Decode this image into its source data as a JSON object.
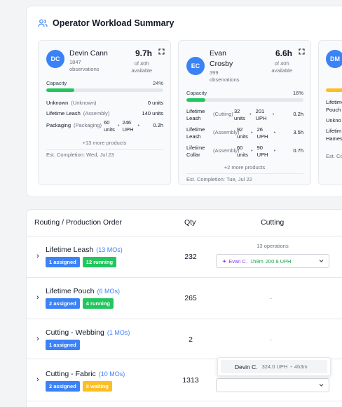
{
  "summary": {
    "title": "Operator Workload Summary",
    "operators": [
      {
        "initials": "DC",
        "name": "Devin Cann",
        "observations": "1847 observations",
        "hours": "9.7h",
        "available_top": "of 40h",
        "available_bottom": "available",
        "capacity_label": "Capacity",
        "capacity_pct": "24%",
        "capacity_value": 24,
        "work": [
          {
            "name": "Unknown",
            "op": "(Unknown)",
            "units": "0 units"
          },
          {
            "name": "Lifetime Leash",
            "op": "(Assembly)",
            "units": "140 units"
          },
          {
            "name": "Packaging",
            "op": "(Packaging)",
            "units_a": "60",
            "units_b": "units",
            "uph_a": "246",
            "uph_b": "UPH",
            "time": "0.2h"
          }
        ],
        "more": "+13 more products",
        "est": "Est. Completion: Wed, Jul 23"
      },
      {
        "initials": "EC",
        "name_a": "Evan",
        "name_b": "Crosby",
        "observations": "399 observations",
        "hours": "6.6h",
        "available_top": "of 40h",
        "available_bottom": "available",
        "capacity_label": "Capacity",
        "capacity_pct": "16%",
        "capacity_value": 16,
        "work": [
          {
            "name_a": "Lifetime",
            "name_b": "Leash",
            "op": "(Cutting)",
            "units_a": "32",
            "units_b": "units",
            "uph_a": "201",
            "uph_b": "UPH",
            "time": "0.2h"
          },
          {
            "name_a": "Lifetime",
            "name_b": "Leash",
            "op": "(Assembly)",
            "units_a": "92",
            "units_b": "units",
            "uph_a": "26",
            "uph_b": "UPH",
            "time": "3.5h"
          },
          {
            "name_a": "Lifetime",
            "name_b": "Collar",
            "op": "(Assembly)",
            "units_a": "60",
            "units_b": "units",
            "uph_a": "90",
            "uph_b": "UPH",
            "time": "0.7h"
          }
        ],
        "more": "+2 more products",
        "est": "Est. Completion: Tue, Jul 22"
      },
      {
        "initials": "DM",
        "work": [
          {
            "name": "Lifetime"
          },
          {
            "name": "Pouch"
          },
          {
            "name": "Unkno"
          },
          {
            "name": "Lifetim"
          },
          {
            "name": "Hames"
          }
        ],
        "est": "Est. Co"
      }
    ]
  },
  "table": {
    "headers": {
      "order": "Routing / Production Order",
      "qty": "Qty",
      "cutting": "Cutting"
    },
    "rows": [
      {
        "name": "Lifetime Leash",
        "mos": "(13 MOs)",
        "badges": [
          "1 assigned",
          "12 running"
        ],
        "qty": "232",
        "ops_label": "13 operations",
        "select_op": "Evan C.",
        "select_time": "1h9m",
        "select_uph": "200.9 UPH"
      },
      {
        "name": "Lifetime Pouch",
        "mos": "(6 MOs)",
        "badges": [
          "2 assigned",
          "4 running"
        ],
        "qty": "265",
        "cutting": "-"
      },
      {
        "name": "Cutting - Webbing",
        "mos": "(1 MOs)",
        "badges": [
          "1 assigned"
        ],
        "qty": "2",
        "cutting": "-"
      },
      {
        "name": "Cutting - Fabric",
        "mos": "(10 MOs)",
        "badges": [
          "2 assigned",
          "8 waiting"
        ],
        "qty": "1313"
      }
    ],
    "dropdown": {
      "name": "Devin C.",
      "uph": "324.0 UPH",
      "sep": "•",
      "duration": "4h3m"
    }
  },
  "colors": {
    "accent": "#3b82f6",
    "running": "#22c55e",
    "waiting": "#fbbf24",
    "operator": "#7c3aed"
  },
  "icons": [
    "users-icon",
    "expand-icon",
    "chevron-right-icon",
    "chevron-down-icon",
    "sparkle-icon"
  ]
}
